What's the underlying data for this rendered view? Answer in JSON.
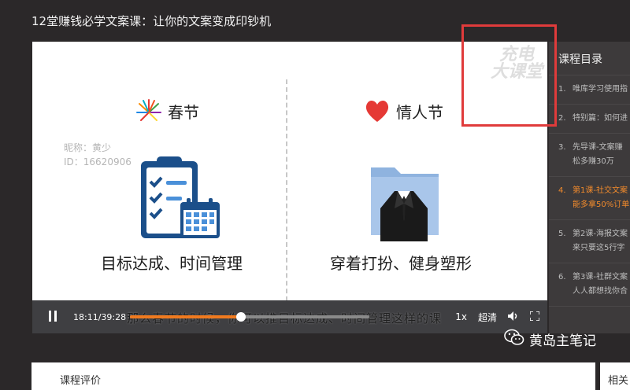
{
  "page": {
    "title": "12堂赚钱必学文案课：让你的文案变成印钞机"
  },
  "video": {
    "slide": {
      "left_heading": "春节",
      "right_heading": "情人节",
      "left_caption": "目标达成、时间管理",
      "right_caption": "穿着打扮、健身塑形",
      "user_nickname": "昵称：黄少",
      "user_id": "ID：16620906",
      "watermark_line1": "充电",
      "watermark_line2": "大课堂"
    },
    "controls": {
      "current_time": "18:11/39:28",
      "progress_fraction": 0.463,
      "subtitle": "那么春节的时候，你可以推目标达成、时间管理这样的课",
      "speed": "1x",
      "quality": "超清"
    },
    "icons": {
      "pause": "pause-icon",
      "volume": "volume-icon",
      "fullscreen": "fullscreen-icon",
      "fireworks": "fireworks-icon",
      "heart": "heart-icon",
      "clipboard": "clipboard-checklist-icon",
      "suit": "suit-folder-icon"
    }
  },
  "sidebar": {
    "title": "课程目录",
    "items": [
      {
        "num": "1.",
        "text": "唯库学习使用指"
      },
      {
        "num": "2.",
        "text": "特别篇：如何进"
      },
      {
        "num": "3.",
        "text": "先导课-文案赚",
        "text2": "松多赚30万"
      },
      {
        "num": "4.",
        "text": "第1课-社交文案",
        "text2": "能多拿50%订单",
        "active": true
      },
      {
        "num": "5.",
        "text": "第2课-海报文案",
        "text2": "来只要这5行字"
      },
      {
        "num": "6.",
        "text": "第3课-社群文案",
        "text2": "人人都想找你合"
      }
    ]
  },
  "bottom": {
    "reviews_label": "课程评价",
    "related_label": "相关"
  },
  "brand": {
    "name": "黄岛主笔记",
    "icon": "wechat-icon"
  },
  "colors": {
    "background": "#2b2829",
    "accent": "#f07a1f",
    "highlight_box": "#e03b3b",
    "active_item": "#f08a2c"
  }
}
